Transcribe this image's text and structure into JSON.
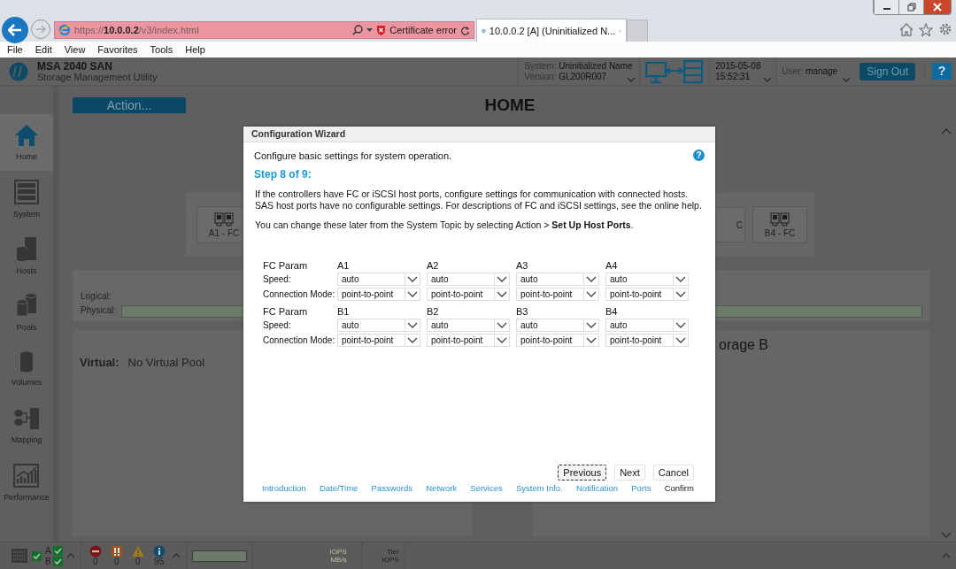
{
  "browser": {
    "url": "https://**10.0.0.2**/v3/index.html",
    "cert_error": "Certificate error",
    "tabs": [
      {
        "label": "10.0.0.2 [A] (Uninitialized N...",
        "selected": true
      }
    ],
    "menu": [
      "File",
      "Edit",
      "View",
      "Favorites",
      "Tools",
      "Help"
    ]
  },
  "header": {
    "product": "MSA 2040 SAN",
    "subtitle": "Storage Management Utility",
    "system_label": "System:",
    "system": "Uninitialized Name",
    "version_label": "Version:",
    "version": "GL200R007",
    "date": "2015-05-08",
    "time": "15:52:31",
    "user_label": "User:",
    "user": "manage",
    "sign_out": "Sign Out",
    "help": "?"
  },
  "nav": [
    {
      "label": "Home",
      "selected": true
    },
    {
      "label": "System",
      "selected": false
    },
    {
      "label": "Hosts",
      "selected": false
    },
    {
      "label": "Pools",
      "selected": false
    },
    {
      "label": "Volumes",
      "selected": false
    },
    {
      "label": "Mapping",
      "selected": false
    },
    {
      "label": "Performance",
      "selected": false
    }
  ],
  "home": {
    "action": "Action...",
    "title": "HOME",
    "ports": [
      "A1 - FC",
      "C",
      "B4 - FC"
    ],
    "logical_label": "Logical:",
    "physical_label": "Physical:",
    "virtual_label": "Virtual:",
    "virtual": "No Virtual Pool",
    "storage_b": "orage B"
  },
  "wizard": {
    "title": "Configuration Wizard",
    "intro": "Configure basic settings for system operation.",
    "help": "?",
    "step": "Step 8 of 9:",
    "description": [
      "If the controllers have FC or iSCSI host ports, configure settings for communication with connected hosts.",
      "SAS host ports have no configurable settings. For descriptions of FC and iSCSI settings, see the online help."
    ],
    "note": "You can change these later from the System Topic by selecting Action > **Set Up Host Ports**.",
    "groups": [
      {
        "header": "FC Param",
        "speed_label": "Speed:",
        "mode_label": "Connection Mode:",
        "ports": [
          {
            "name": "A1",
            "speed": "auto",
            "mode": "point-to-point"
          },
          {
            "name": "A2",
            "speed": "auto",
            "mode": "point-to-point"
          },
          {
            "name": "A3",
            "speed": "auto",
            "mode": "point-to-point"
          },
          {
            "name": "A4",
            "speed": "auto",
            "mode": "point-to-point"
          }
        ]
      },
      {
        "header": "FC Param",
        "speed_label": "Speed:",
        "mode_label": "Connection Mode:",
        "ports": [
          {
            "name": "B1",
            "speed": "auto",
            "mode": "point-to-point"
          },
          {
            "name": "B2",
            "speed": "auto",
            "mode": "point-to-point"
          },
          {
            "name": "B3",
            "speed": "auto",
            "mode": "point-to-point"
          },
          {
            "name": "B4",
            "speed": "auto",
            "mode": "point-to-point"
          }
        ]
      }
    ],
    "buttons": [
      {
        "label": "Previous",
        "focused": true
      },
      {
        "label": "Next",
        "focused": false
      },
      {
        "label": "Cancel",
        "focused": false
      }
    ],
    "steps": [
      {
        "label": "Introduction",
        "disabled": false
      },
      {
        "label": "Date/Time",
        "disabled": false
      },
      {
        "label": "Passwords",
        "disabled": false
      },
      {
        "label": "Network",
        "disabled": false
      },
      {
        "label": "Services",
        "disabled": false
      },
      {
        "label": "System Info.",
        "disabled": false
      },
      {
        "label": "Notification",
        "disabled": false
      },
      {
        "label": "Ports",
        "disabled": false
      },
      {
        "label": "Confirm",
        "disabled": true
      }
    ]
  },
  "status": {
    "controllers": [
      {
        "label": "A",
        "ok": true
      },
      {
        "label": "B",
        "ok": true
      }
    ],
    "alerts": [
      {
        "kind": "error",
        "count": "0"
      },
      {
        "kind": "critical",
        "count": "0"
      },
      {
        "kind": "warning",
        "count": "0"
      },
      {
        "kind": "info",
        "count": "95"
      }
    ],
    "iops": "IOPS",
    "mbs": "MB/s",
    "tier": "Tier",
    "tier_iops": "IOPS"
  }
}
